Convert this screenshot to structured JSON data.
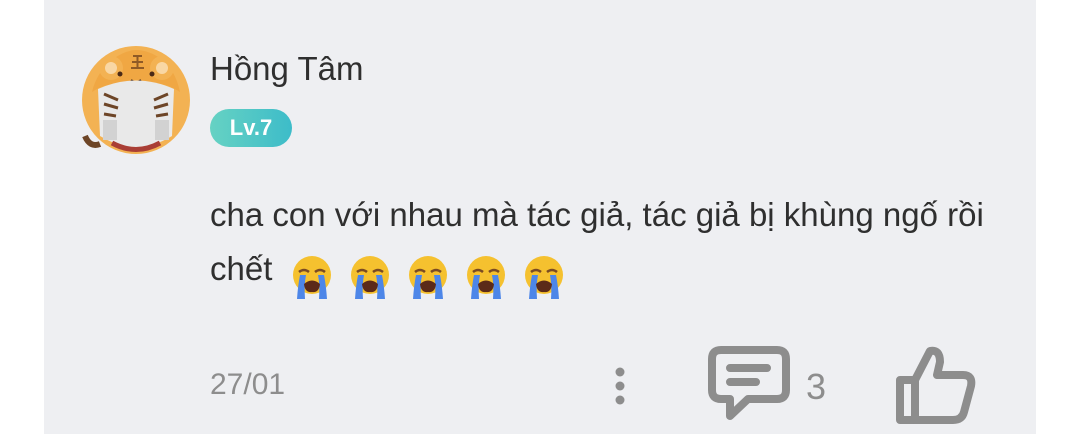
{
  "comment": {
    "username": "Hồng Tâm",
    "level": "Lv.7",
    "text": "cha con với nhau mà tác giả, tác giả bị khùng ngố rồi chết",
    "emoji_names": [
      "loudly-crying-face",
      "loudly-crying-face",
      "loudly-crying-face",
      "loudly-crying-face",
      "loudly-crying-face"
    ],
    "date": "27/01",
    "reply_count": "3",
    "icons": {
      "avatar": "tiger-hood-avatar",
      "more": "more-vertical-icon",
      "reply": "comment-bubble-icon",
      "like": "thumbs-up-icon"
    }
  },
  "colors": {
    "card_background": "#eeeff2",
    "level_badge_start": "#66d2c3",
    "level_badge_end": "#3dbcc9",
    "icon_gray": "#8d8d8d",
    "text_dark": "#2f2f2f"
  }
}
